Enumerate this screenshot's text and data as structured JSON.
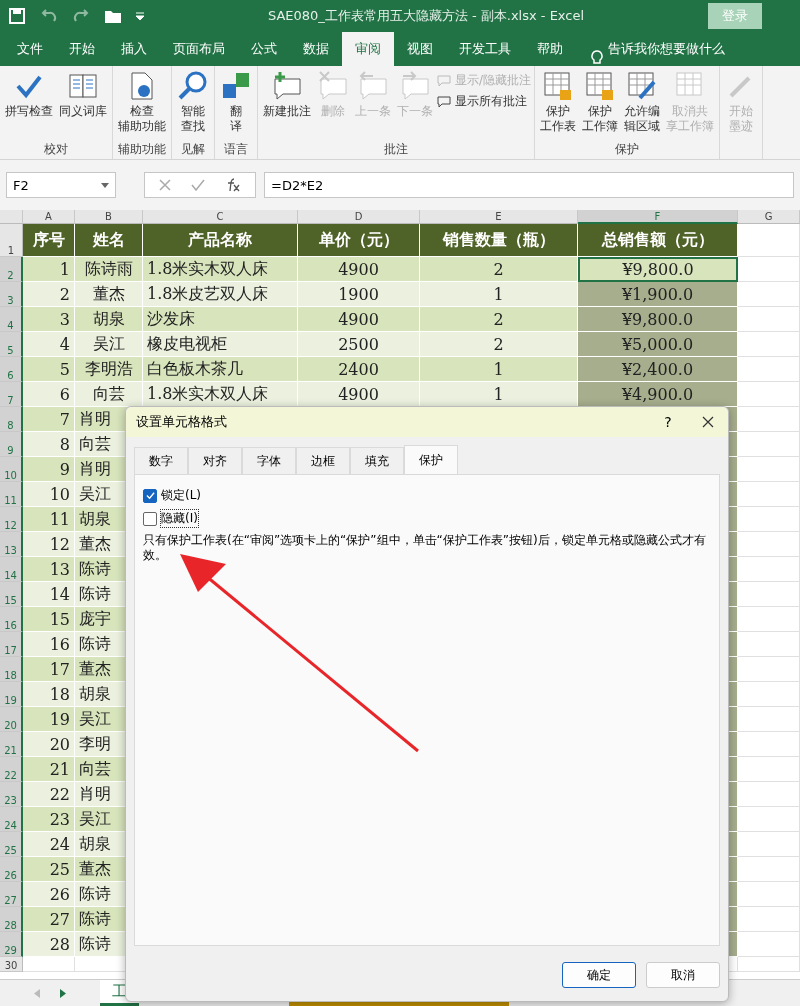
{
  "window": {
    "title": "SAE080_工作表常用五大隐藏方法 - 副本.xlsx  -  Excel",
    "login": "登录"
  },
  "menu_tabs": [
    {
      "label": "文件",
      "selected": false
    },
    {
      "label": "开始",
      "selected": false
    },
    {
      "label": "插入",
      "selected": false
    },
    {
      "label": "页面布局",
      "selected": false
    },
    {
      "label": "公式",
      "selected": false
    },
    {
      "label": "数据",
      "selected": false
    },
    {
      "label": "审阅",
      "selected": true
    },
    {
      "label": "视图",
      "selected": false
    },
    {
      "label": "开发工具",
      "selected": false
    },
    {
      "label": "帮助",
      "selected": false
    }
  ],
  "tell_me": "告诉我你想要做什么",
  "ribbon": [
    {
      "label": "校对",
      "buttons": [
        {
          "lines": [
            "拼写检查"
          ],
          "disabled": false
        },
        {
          "lines": [
            "同义词库"
          ],
          "disabled": false
        }
      ]
    },
    {
      "label": "辅助功能",
      "buttons": [
        {
          "lines": [
            "检查",
            "辅助功能"
          ],
          "disabled": false
        }
      ]
    },
    {
      "label": "见解",
      "buttons": [
        {
          "lines": [
            "智能",
            "查找"
          ],
          "disabled": false
        }
      ]
    },
    {
      "label": "语言",
      "buttons": [
        {
          "lines": [
            "翻",
            "译"
          ],
          "disabled": false
        }
      ]
    },
    {
      "label": "批注",
      "buttons": [
        {
          "lines": [
            "新建批注"
          ],
          "disabled": false
        },
        {
          "lines": [
            "删除"
          ],
          "disabled": true
        },
        {
          "lines": [
            "上一条"
          ],
          "disabled": true
        },
        {
          "lines": [
            "下一条"
          ],
          "disabled": true
        }
      ],
      "small": [
        {
          "label": "显示/隐藏批注",
          "disabled": true
        },
        {
          "label": "显示所有批注",
          "disabled": false
        }
      ]
    },
    {
      "label": "保护",
      "buttons": [
        {
          "lines": [
            "保护",
            "工作表"
          ],
          "disabled": false
        },
        {
          "lines": [
            "保护",
            "工作簿"
          ],
          "disabled": false
        },
        {
          "lines": [
            "允许编",
            "辑区域"
          ],
          "disabled": false
        },
        {
          "lines": [
            "取消共",
            "享工作簿"
          ],
          "disabled": true
        }
      ]
    },
    {
      "buttons": [
        {
          "lines": [
            "开始",
            "墨迹"
          ],
          "disabled": true
        }
      ]
    }
  ],
  "name_box": "F2",
  "formula": "=D2*E2",
  "columns": [
    {
      "label": "A",
      "selected": false
    },
    {
      "label": "B",
      "selected": false
    },
    {
      "label": "C",
      "selected": false
    },
    {
      "label": "D",
      "selected": false
    },
    {
      "label": "E",
      "selected": false
    },
    {
      "label": "F",
      "selected": true
    },
    {
      "label": "G",
      "selected": false
    }
  ],
  "rows": [
    {
      "n": "1",
      "kind": "header",
      "selected": false,
      "cells": [
        "序号",
        "姓名",
        "产品名称",
        "单价（元）",
        "销售数量（瓶）",
        "总销售额（元）"
      ]
    },
    {
      "n": "2",
      "kind": "data",
      "selected": true,
      "active": true,
      "cells": [
        "1",
        "陈诗雨",
        "1.8米实木双人床",
        "4900",
        "2",
        "¥9,800.0"
      ]
    },
    {
      "n": "3",
      "kind": "data",
      "selected": true,
      "active": false,
      "cells": [
        "2",
        "董杰",
        "1.8米皮艺双人床",
        "1900",
        "1",
        "¥1,900.0"
      ]
    },
    {
      "n": "4",
      "kind": "data",
      "selected": true,
      "active": false,
      "cells": [
        "3",
        "胡泉",
        "沙发床",
        "4900",
        "2",
        "¥9,800.0"
      ]
    },
    {
      "n": "5",
      "kind": "data",
      "selected": true,
      "active": false,
      "cells": [
        "4",
        "吴江",
        "橡皮电视柜",
        "2500",
        "2",
        "¥5,000.0"
      ]
    },
    {
      "n": "6",
      "kind": "data",
      "selected": true,
      "active": false,
      "cells": [
        "5",
        "李明浩",
        "白色板木茶几",
        "2400",
        "1",
        "¥2,400.0"
      ]
    },
    {
      "n": "7",
      "kind": "data",
      "selected": true,
      "active": false,
      "cells": [
        "6",
        "向芸",
        "1.8米实木双人床",
        "4900",
        "1",
        "¥4,900.0"
      ]
    },
    {
      "n": "8",
      "kind": "data",
      "selected": true,
      "active": false,
      "cells": [
        "7",
        "肖明"
      ]
    },
    {
      "n": "9",
      "kind": "data",
      "selected": true,
      "active": false,
      "cells": [
        "8",
        "向芸"
      ]
    },
    {
      "n": "10",
      "kind": "data",
      "selected": true,
      "active": false,
      "cells": [
        "9",
        "肖明"
      ]
    },
    {
      "n": "11",
      "kind": "data",
      "selected": true,
      "active": false,
      "cells": [
        "10",
        "吴江"
      ]
    },
    {
      "n": "12",
      "kind": "data",
      "selected": true,
      "active": false,
      "cells": [
        "11",
        "胡泉"
      ]
    },
    {
      "n": "13",
      "kind": "data",
      "selected": true,
      "active": false,
      "cells": [
        "12",
        "董杰"
      ]
    },
    {
      "n": "14",
      "kind": "data",
      "selected": true,
      "active": false,
      "cells": [
        "13",
        "陈诗"
      ]
    },
    {
      "n": "15",
      "kind": "data",
      "selected": true,
      "active": false,
      "cells": [
        "14",
        "陈诗"
      ]
    },
    {
      "n": "16",
      "kind": "data",
      "selected": true,
      "active": false,
      "cells": [
        "15",
        "庞宇"
      ]
    },
    {
      "n": "17",
      "kind": "data",
      "selected": true,
      "active": false,
      "cells": [
        "16",
        "陈诗"
      ]
    },
    {
      "n": "18",
      "kind": "data",
      "selected": true,
      "active": false,
      "cells": [
        "17",
        "董杰"
      ]
    },
    {
      "n": "19",
      "kind": "data",
      "selected": true,
      "active": false,
      "cells": [
        "18",
        "胡泉"
      ]
    },
    {
      "n": "20",
      "kind": "data",
      "selected": true,
      "active": false,
      "cells": [
        "19",
        "吴江"
      ]
    },
    {
      "n": "21",
      "kind": "data",
      "selected": true,
      "active": false,
      "cells": [
        "20",
        "李明"
      ]
    },
    {
      "n": "22",
      "kind": "data",
      "selected": true,
      "active": false,
      "cells": [
        "21",
        "向芸"
      ]
    },
    {
      "n": "23",
      "kind": "data",
      "selected": true,
      "active": false,
      "cells": [
        "22",
        "肖明"
      ]
    },
    {
      "n": "24",
      "kind": "data",
      "selected": true,
      "active": false,
      "cells": [
        "23",
        "吴江"
      ]
    },
    {
      "n": "25",
      "kind": "data",
      "selected": true,
      "active": false,
      "cells": [
        "24",
        "胡泉"
      ]
    },
    {
      "n": "26",
      "kind": "data",
      "selected": true,
      "active": false,
      "cells": [
        "25",
        "董杰"
      ]
    },
    {
      "n": "27",
      "kind": "data",
      "selected": true,
      "active": false,
      "cells": [
        "26",
        "陈诗"
      ]
    },
    {
      "n": "28",
      "kind": "data",
      "selected": true,
      "active": false,
      "cells": [
        "27",
        "陈诗"
      ]
    },
    {
      "n": "29",
      "kind": "data",
      "selected": true,
      "active": false,
      "cells": [
        "28",
        "陈诗"
      ]
    },
    {
      "n": "30",
      "kind": "empty",
      "selected": false,
      "cells": []
    }
  ],
  "sheet_tabs": [
    {
      "label": "工",
      "selected": true
    },
    {
      "selected": false
    }
  ],
  "dialog": {
    "title": "设置单元格格式",
    "help": "?",
    "tabs": [
      {
        "label": "数字",
        "selected": false
      },
      {
        "label": "对齐",
        "selected": false
      },
      {
        "label": "字体",
        "selected": false
      },
      {
        "label": "边框",
        "selected": false
      },
      {
        "label": "填充",
        "selected": false
      },
      {
        "label": "保护",
        "selected": true
      }
    ],
    "options": [
      {
        "label": "锁定(L)",
        "checked": true,
        "focused": false
      },
      {
        "label": "隐藏(I)",
        "checked": false,
        "focused": true
      }
    ],
    "note": "只有保护工作表(在“审阅”选项卡上的“保护”组中，单击“保护工作表”按钮)后，锁定单元格或隐藏公式才有效。",
    "buttons": [
      "确定",
      "取消"
    ]
  }
}
